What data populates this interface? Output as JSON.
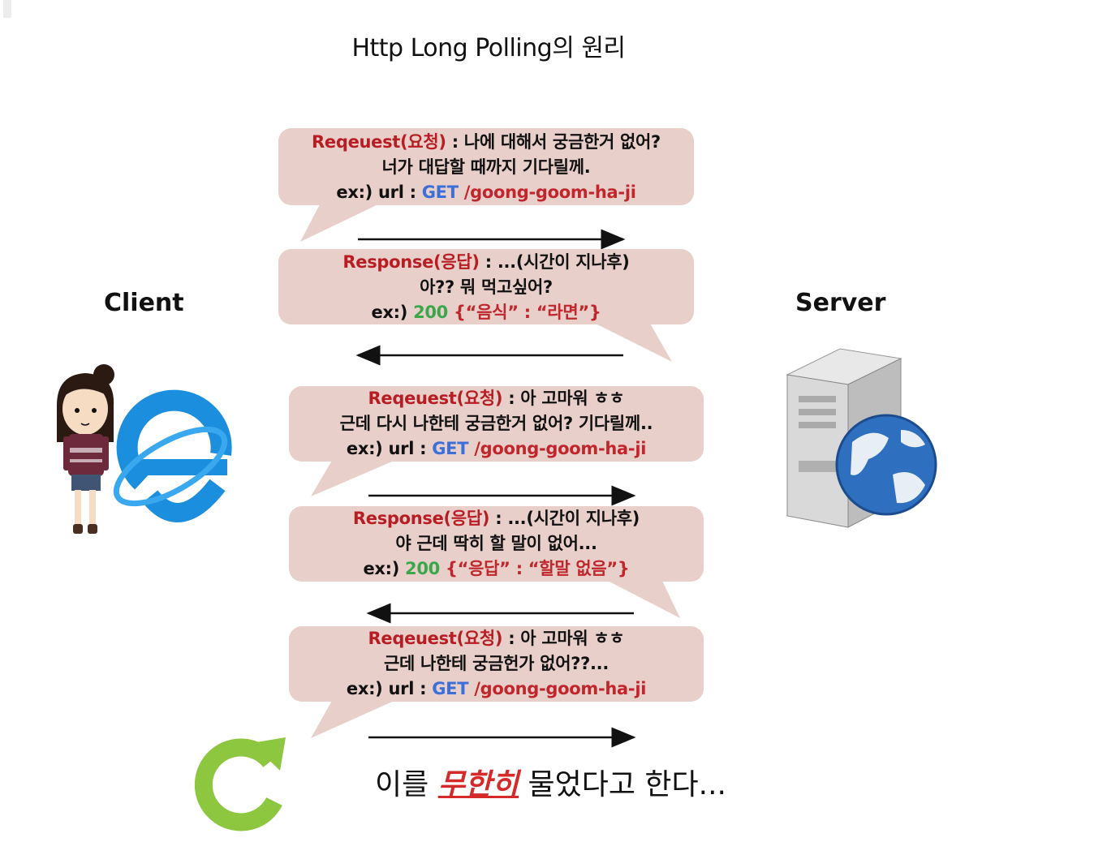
{
  "title": "Http Long Polling의 원리",
  "actors": {
    "client": "Client",
    "server": "Server"
  },
  "icons": {
    "client": [
      "girl-character-icon",
      "internet-explorer-icon"
    ],
    "server": [
      "server-globe-icon"
    ],
    "loop": "refresh-loop-icon"
  },
  "colors": {
    "bubble": "#e8cfc9",
    "keyword_red": "#b81d24",
    "get_blue": "#3d6fd8",
    "status_green": "#3aa84a",
    "loop_green": "#8dc63f"
  },
  "messages": [
    {
      "direction": "client-to-server",
      "keyword": "Reqeuest(요청)",
      "line1_rest": " : 나에 대해서 궁금한거 없어?",
      "line2": "너가 대답할 때까지 기다릴께.",
      "ex_prefix": "ex:) ",
      "ex_mid": "url : ",
      "ex_tag": "GET",
      "ex_value": " /goong-goom-ha-ji"
    },
    {
      "direction": "server-to-client",
      "keyword": "Response(응답)",
      "line1_rest": " : ...(시간이 지나후)",
      "line2": "아?? 뭐 먹고싶어?",
      "ex_prefix": "ex:) ",
      "ex_mid": "",
      "ex_tag": "200",
      "ex_value": " {“음식” : “라면”}"
    },
    {
      "direction": "client-to-server",
      "keyword": "Reqeuest(요청)",
      "line1_rest": " : 아 고마워 ㅎㅎ",
      "line2": "근데 다시 나한테 궁금한거 없어? 기다릴께..",
      "ex_prefix": "ex:) ",
      "ex_mid": "url : ",
      "ex_tag": "GET",
      "ex_value": " /goong-goom-ha-ji"
    },
    {
      "direction": "server-to-client",
      "keyword": "Response(응답)",
      "line1_rest": " : ...(시간이 지나후)",
      "line2": "야 근데 딱히 할 말이 없어...",
      "ex_prefix": "ex:) ",
      "ex_mid": "",
      "ex_tag": "200",
      "ex_value": " {“응답” : “할말 없음”}"
    },
    {
      "direction": "client-to-server",
      "keyword": "Reqeuest(요청)",
      "line1_rest": " : 아 고마워 ㅎㅎ",
      "line2": "근데 나한테 궁금헌가 없어??...",
      "ex_prefix": "ex:) ",
      "ex_mid": "url : ",
      "ex_tag": "GET",
      "ex_value": " /goong-goom-ha-ji"
    }
  ],
  "footer": {
    "before": "이를 ",
    "emphasis": "무한히",
    "after": " 물었다고 한다..."
  }
}
